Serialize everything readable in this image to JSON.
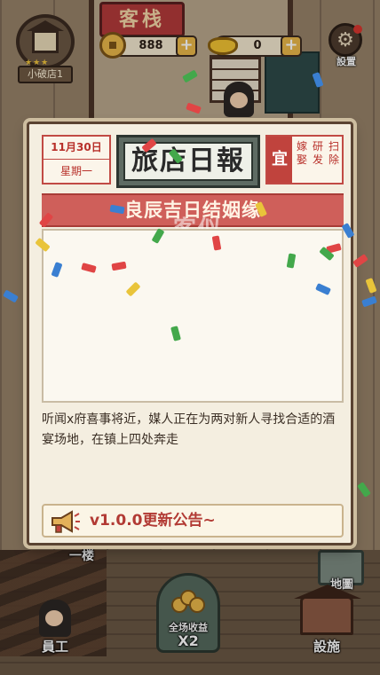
{
  "scene": {
    "inn_sign": "客栈",
    "floor_label": "一楼"
  },
  "hud": {
    "shop_name": "小破店1",
    "shop_stars": "★★★",
    "coins": "888",
    "ingots": "0",
    "plus": "+",
    "settings_label": "設置",
    "settings_icon": "gear-icon"
  },
  "daily": {
    "date": "11月30日",
    "weekday": "星期一",
    "title": "旅店日報",
    "yi_label": "宜",
    "yi_items": [
      "嫁娶",
      "研发",
      "扫除"
    ],
    "headline": "良辰吉日结姻缘",
    "headline_ghost": "客似",
    "description": "听闻x府喜事将近，媒人正在为两对新人寻找合适的酒宴场地，在镇上四处奔走",
    "notice": "v1.0.0更新公告~"
  },
  "bottom": {
    "staff_label": "員工",
    "income_label": "全场收益",
    "income_multiplier": "X2",
    "facility_label": "設施",
    "map_label": "地圖"
  },
  "colors": {
    "accent_red": "#c0433d",
    "panel_bg": "#f4eee0",
    "title_green": "#5e6b63",
    "gold": "#e9b74a"
  }
}
